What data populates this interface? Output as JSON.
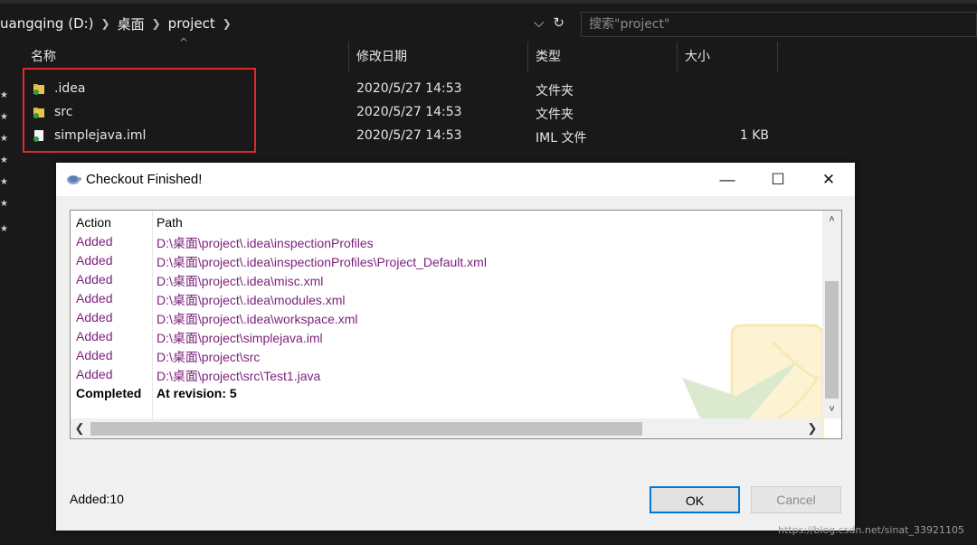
{
  "explorer": {
    "breadcrumb": [
      {
        "label": "uangqing (D:)"
      },
      {
        "label": "桌面"
      },
      {
        "label": "project"
      }
    ],
    "search_placeholder": "搜索\"project\"",
    "columns": {
      "name": "名称",
      "modified": "修改日期",
      "type": "类型",
      "size": "大小"
    },
    "files": [
      {
        "name": ".idea",
        "modified": "2020/5/27 14:53",
        "type": "文件夹",
        "size": "",
        "icon": "folder-svn-icon"
      },
      {
        "name": "src",
        "modified": "2020/5/27 14:53",
        "type": "文件夹",
        "size": "",
        "icon": "folder-svn-icon"
      },
      {
        "name": "simplejava.iml",
        "modified": "2020/5/27 14:53",
        "type": "IML 文件",
        "size": "1 KB",
        "icon": "file-svn-icon"
      }
    ],
    "highlight_color": "#e0282d"
  },
  "dialog": {
    "title": "Checkout Finished!",
    "columns": {
      "action": "Action",
      "path": "Path"
    },
    "rows": [
      {
        "action": "Added",
        "path": "D:\\桌面\\project\\.idea\\inspectionProfiles"
      },
      {
        "action": "Added",
        "path": "D:\\桌面\\project\\.idea\\inspectionProfiles\\Project_Default.xml"
      },
      {
        "action": "Added",
        "path": "D:\\桌面\\project\\.idea\\misc.xml"
      },
      {
        "action": "Added",
        "path": "D:\\桌面\\project\\.idea\\modules.xml"
      },
      {
        "action": "Added",
        "path": "D:\\桌面\\project\\.idea\\workspace.xml"
      },
      {
        "action": "Added",
        "path": "D:\\桌面\\project\\simplejava.iml"
      },
      {
        "action": "Added",
        "path": "D:\\桌面\\project\\src"
      },
      {
        "action": "Added",
        "path": "D:\\桌面\\project\\src\\Test1.java"
      },
      {
        "action": "Completed",
        "path": "At revision: 5"
      }
    ],
    "status": "Added:10",
    "ok_label": "OK",
    "cancel_label": "Cancel",
    "added_color": "#7b1f7b"
  },
  "credit": "https://blog.csdn.net/sinat_33921105"
}
